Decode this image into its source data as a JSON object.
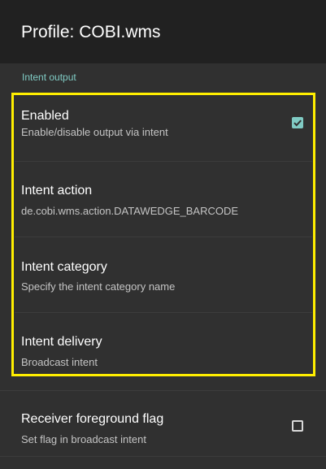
{
  "appbar": {
    "title": "Profile: COBI.wms"
  },
  "section": {
    "header": "Intent output"
  },
  "prefs": [
    {
      "title": "Enabled",
      "summary": "Enable/disable output via intent",
      "checked": true
    },
    {
      "title": "Intent action",
      "summary": "de.cobi.wms.action.DATAWEDGE_BARCODE"
    },
    {
      "title": "Intent category",
      "summary": "Specify the intent category name"
    },
    {
      "title": "Intent delivery",
      "summary": "Broadcast intent"
    },
    {
      "title": "Receiver foreground flag",
      "summary": "Set flag in broadcast intent",
      "checked": false
    }
  ],
  "colors": {
    "accent": "#80cbc4",
    "highlight": "#ffee00",
    "background": "#303030",
    "appbar": "#212121"
  }
}
